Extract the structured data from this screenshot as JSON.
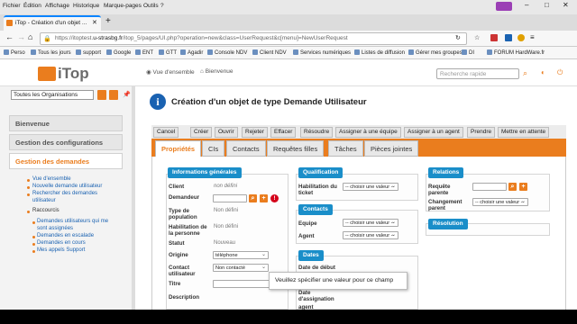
{
  "browser": {
    "menu": [
      "Fichier",
      "Édition",
      "Affichage",
      "Historique",
      "Marque-pages",
      "Outils",
      "?"
    ],
    "tab_title": "iTop - Création d'un objet ...",
    "url_prefix": "https://itoptest.",
    "url_domain": "u-strasbg.fr",
    "url_path": "/itop_5/pages/UI.php?operation=new&class=UserRequest&c[menu]=NewUserRequest",
    "bookmarks": [
      "Perso",
      "Tous les jours",
      "support",
      "Google",
      "ENT",
      "GTT",
      "Agadir",
      "Console NDV",
      "Client NDV",
      "Services numériques",
      "Listes de diffusion",
      "Gérer mes groupes",
      "DI",
      "FORUM HardWare.fr"
    ]
  },
  "itop": {
    "logo_text": "iTop",
    "breadcrumb": [
      "Vue d'ensemble",
      "Bienvenue"
    ],
    "search_placeholder": "Recherche rapide",
    "org_select": "Toutes les Organisations"
  },
  "nav": {
    "welcome": "Bienvenue",
    "config": "Gestion des configurations",
    "requests": "Gestion des demandes",
    "links": [
      "Vue d'ensemble",
      "Nouvelle demande utilisateur",
      "Rechercher des demandes utilisateur"
    ],
    "shortcuts_title": "Raccourcis",
    "shortcuts": [
      "Demandes utilisateurs qui me sont assignées",
      "Demandes en escalade",
      "Demandes en cours",
      "Mes appels Support"
    ]
  },
  "page": {
    "title": "Création d'un objet de type Demande Utilisateur",
    "actions": [
      "Cancel",
      "Créer",
      "Ouvrir",
      "Rejeter",
      "Effacer",
      "Résoudre",
      "Assigner à une équipe",
      "Assigner à un agent",
      "Prendre",
      "Mettre en attente"
    ],
    "tabs": [
      "Propriétés",
      "CIs",
      "Contacts",
      "Requêtes filles",
      "Tâches",
      "Pièces jointes"
    ]
  },
  "form": {
    "general": {
      "title": "Informations générales",
      "client_label": "Client",
      "client_value": "non défini",
      "requester_label": "Demandeur",
      "pop_type_label": "Type de population",
      "pop_type_value": "Non défini",
      "enabling_label": "Habilitation de la personne",
      "enabling_value": "Non défini",
      "status_label": "Statut",
      "status_value": "Nouveau",
      "origin_label": "Origine",
      "origin_value": "téléphone",
      "contact_label": "Contact utilisateur",
      "contact_value": "Non contacté",
      "titre_label": "Titre",
      "desc_label": "Description"
    },
    "qualification": {
      "title": "Qualification",
      "ticket_label": "Habilitation du ticket",
      "ticket_value": "-- choisir une valeur --"
    },
    "contacts": {
      "title": "Contacts",
      "team_label": "Equipe",
      "team_value": "-- choisir une valeur --",
      "agent_label": "Agent",
      "agent_value": "-- choisir une valeur --"
    },
    "dates": {
      "title": "Dates",
      "start_label": "Date de début",
      "assign_label": "Date d'assignation",
      "agent_label": "agent"
    },
    "relations": {
      "title": "Relations",
      "parent_label": "Requête parente",
      "parent_change_label": "Changement parent",
      "parent_change_value": "-- choisir une valeur --"
    },
    "resolution": {
      "title": "Résolution"
    }
  },
  "tooltip": "Veuillez spécifier une valeur pour ce champ",
  "colors": {
    "accent": "#ea7d1e",
    "section": "#1a8ec9",
    "link": "#1a62b1"
  }
}
